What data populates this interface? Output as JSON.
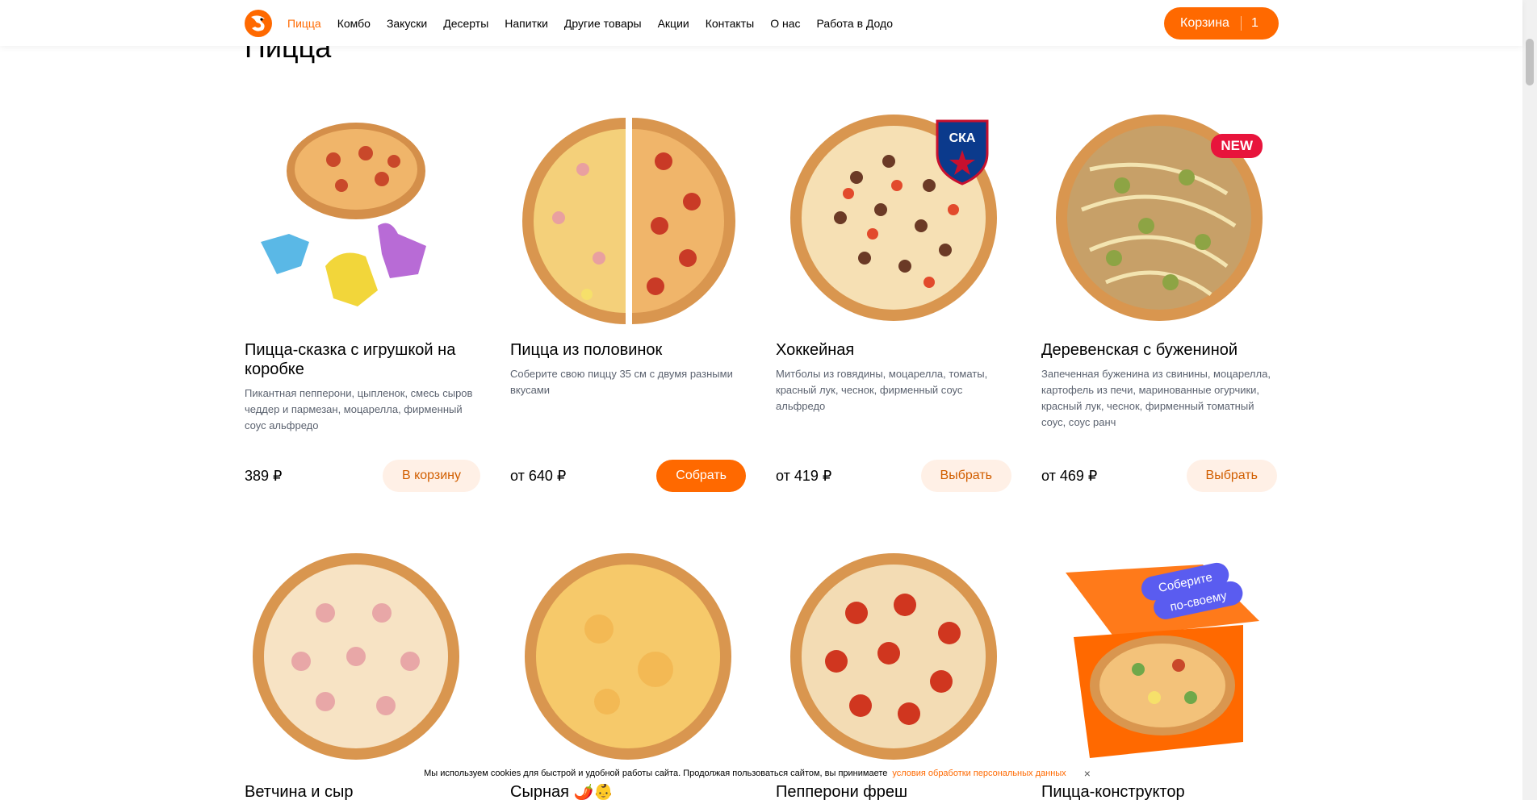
{
  "header": {
    "nav": [
      "Пицца",
      "Комбо",
      "Закуски",
      "Десерты",
      "Напитки",
      "Другие товары",
      "Акции",
      "Контакты",
      "О нас",
      "Работа в Додо"
    ],
    "cart_label": "Корзина",
    "cart_count": "1"
  },
  "section_title": "Пицца",
  "products": [
    {
      "name": "Пицца-сказка с игрушкой на коробке",
      "description": "Пикантная пепперони, цыпленок, смесь сыров чеддер и пармезан, моцарелла, фирменный соус альфредо",
      "price": "389 ₽",
      "button": "В корзину"
    },
    {
      "name": "Пицца из половинок",
      "description": "Соберите свою пиццу 35 см с двумя разными вкусами",
      "price": "от 640 ₽",
      "button": "Собрать"
    },
    {
      "name": "Хоккейная",
      "description": "Митболы из говядины, моцарелла, томаты, красный лук, чеснок, фирменный соус альфредо",
      "price": "от 419 ₽",
      "button": "Выбрать",
      "badge": "СКА"
    },
    {
      "name": "Деревенская с бужениной",
      "description": "Запеченная буженина из свинины, моцарелла, картофель из печи, маринованные огурчики, красный лук, чеснок, фирменный томатный соус, соус ранч",
      "price": "от 469 ₽",
      "button": "Выбрать",
      "badge": "NEW"
    },
    {
      "name": "Ветчина и сыр"
    },
    {
      "name": "Сырная 🌶️👶"
    },
    {
      "name": "Пепперони фреш"
    },
    {
      "name": "Пицца-конструктор",
      "sticker": [
        "Соберите",
        "по-своему"
      ]
    }
  ],
  "cookie": {
    "text": "Мы используем cookies для быстрой и удобной работы сайта. Продолжая пользоваться сайтом, вы принимаете",
    "link": "условия обработки персональных данных",
    "close": "×"
  }
}
